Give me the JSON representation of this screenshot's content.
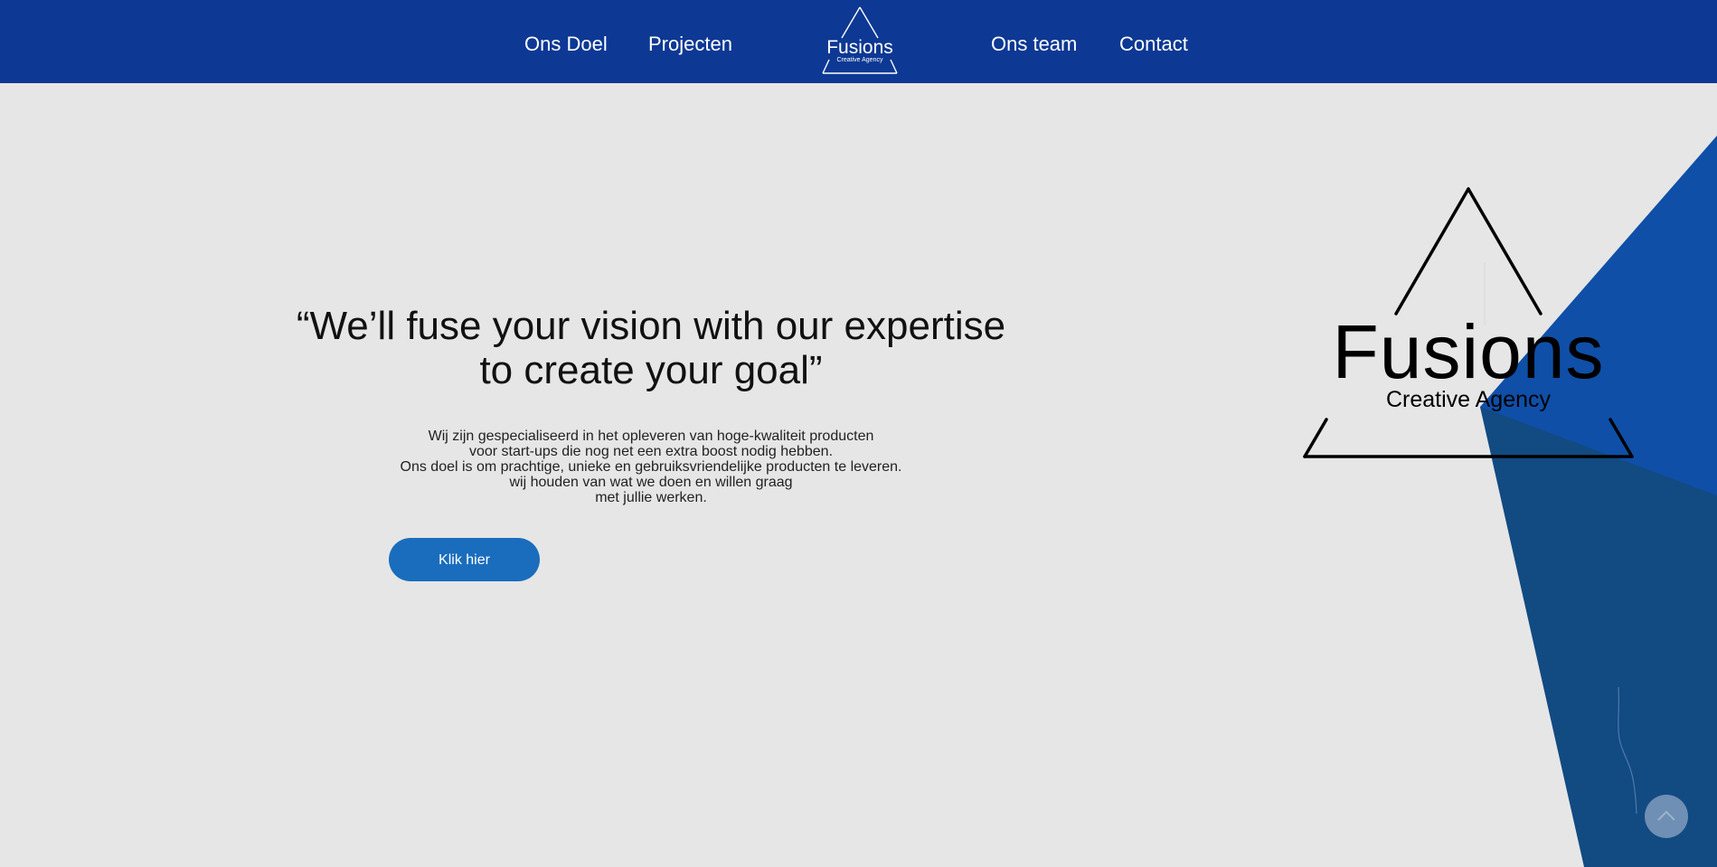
{
  "nav": {
    "links": [
      {
        "label": "Ons Doel"
      },
      {
        "label": "Projecten"
      },
      {
        "label": "Ons team"
      },
      {
        "label": "Contact"
      }
    ],
    "logo": {
      "title": "Fusions",
      "subtitle": "Creative Agency"
    }
  },
  "hero": {
    "quote_lines": [
      "“We’ll fuse your vision with our expertise",
      "to create your goal”"
    ],
    "text_lines": [
      "Wij zijn gespecialiseerd in het opleveren van hoge-kwaliteit producten",
      "voor start-ups die nog net een extra boost nodig hebben.",
      "Ons doel is om prachtige, unieke en gebruiksvriendelijke producten te leveren.",
      "wij houden van wat we doen en willen graag",
      "met jullie werken."
    ],
    "cta_label": "Klik hier"
  },
  "big_logo": {
    "title": "Fusions",
    "subtitle": "Creative Agency"
  },
  "scroll_top": {
    "icon": "chevron-up-icon"
  },
  "colors": {
    "header": "#0d3894",
    "background": "#e6e6e6",
    "accent_shape_light": "#0f4fa8",
    "accent_shape_dark": "#124a82",
    "button": "#1a6dbd",
    "scroll_button": "#6f8fb4"
  }
}
